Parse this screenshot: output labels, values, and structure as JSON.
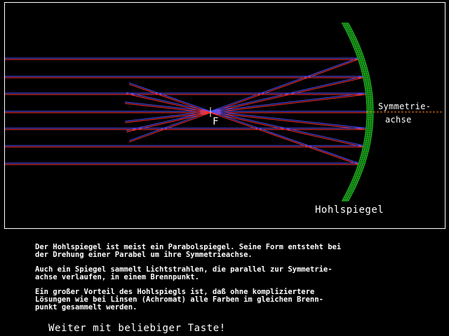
{
  "diagram": {
    "focus_label": "F",
    "symmetry_label_line1": "Symmetrie-",
    "symmetry_label_line2": "achse",
    "mirror_label": "Hohlspiegel",
    "colors": {
      "ray_red": "#ff3030",
      "ray_blue": "#5050ff",
      "mirror_green": "#22c022",
      "axis_orange": "#ff8020",
      "frame": "#ffffff"
    }
  },
  "text": {
    "paragraph1": "Der Hohlspiegel ist meist ein Parabolspiegel. Seine Form entsteht bei\nder Drehung einer Parabel um ihre Symmetrieachse.",
    "paragraph2": "Auch ein Spiegel sammelt Lichtstrahlen, die parallel zur Symmetrie-\nachse verlaufen, in einem Brennpunkt.",
    "paragraph3": "Ein großer Vorteil des Hohlspiegls ist, daß ohne kompliziertere\nLösungen wie bei Linsen (Achromat) alle Farben im gleichen Brenn-\npunkt gesammelt werden."
  },
  "prompt": "Weiter mit beliebiger Taste!"
}
